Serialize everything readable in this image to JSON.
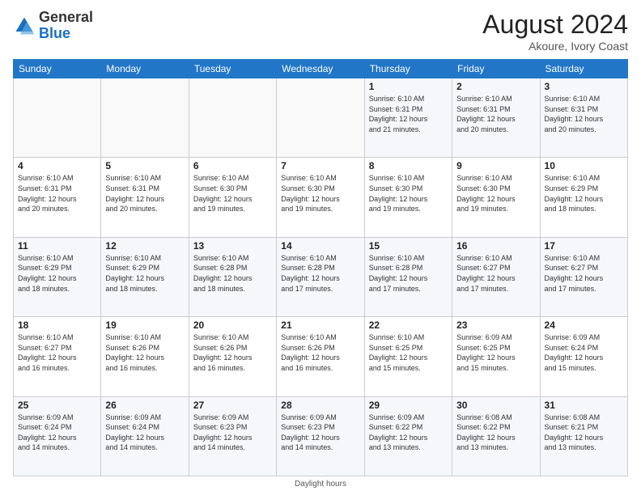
{
  "header": {
    "logo_general": "General",
    "logo_blue": "Blue",
    "month_year": "August 2024",
    "location": "Akoure, Ivory Coast"
  },
  "footer": {
    "daylight_label": "Daylight hours"
  },
  "days_of_week": [
    "Sunday",
    "Monday",
    "Tuesday",
    "Wednesday",
    "Thursday",
    "Friday",
    "Saturday"
  ],
  "weeks": [
    [
      {
        "num": "",
        "info": ""
      },
      {
        "num": "",
        "info": ""
      },
      {
        "num": "",
        "info": ""
      },
      {
        "num": "",
        "info": ""
      },
      {
        "num": "1",
        "info": "Sunrise: 6:10 AM\nSunset: 6:31 PM\nDaylight: 12 hours\nand 21 minutes."
      },
      {
        "num": "2",
        "info": "Sunrise: 6:10 AM\nSunset: 6:31 PM\nDaylight: 12 hours\nand 20 minutes."
      },
      {
        "num": "3",
        "info": "Sunrise: 6:10 AM\nSunset: 6:31 PM\nDaylight: 12 hours\nand 20 minutes."
      }
    ],
    [
      {
        "num": "4",
        "info": "Sunrise: 6:10 AM\nSunset: 6:31 PM\nDaylight: 12 hours\nand 20 minutes."
      },
      {
        "num": "5",
        "info": "Sunrise: 6:10 AM\nSunset: 6:31 PM\nDaylight: 12 hours\nand 20 minutes."
      },
      {
        "num": "6",
        "info": "Sunrise: 6:10 AM\nSunset: 6:30 PM\nDaylight: 12 hours\nand 19 minutes."
      },
      {
        "num": "7",
        "info": "Sunrise: 6:10 AM\nSunset: 6:30 PM\nDaylight: 12 hours\nand 19 minutes."
      },
      {
        "num": "8",
        "info": "Sunrise: 6:10 AM\nSunset: 6:30 PM\nDaylight: 12 hours\nand 19 minutes."
      },
      {
        "num": "9",
        "info": "Sunrise: 6:10 AM\nSunset: 6:30 PM\nDaylight: 12 hours\nand 19 minutes."
      },
      {
        "num": "10",
        "info": "Sunrise: 6:10 AM\nSunset: 6:29 PM\nDaylight: 12 hours\nand 18 minutes."
      }
    ],
    [
      {
        "num": "11",
        "info": "Sunrise: 6:10 AM\nSunset: 6:29 PM\nDaylight: 12 hours\nand 18 minutes."
      },
      {
        "num": "12",
        "info": "Sunrise: 6:10 AM\nSunset: 6:29 PM\nDaylight: 12 hours\nand 18 minutes."
      },
      {
        "num": "13",
        "info": "Sunrise: 6:10 AM\nSunset: 6:28 PM\nDaylight: 12 hours\nand 18 minutes."
      },
      {
        "num": "14",
        "info": "Sunrise: 6:10 AM\nSunset: 6:28 PM\nDaylight: 12 hours\nand 17 minutes."
      },
      {
        "num": "15",
        "info": "Sunrise: 6:10 AM\nSunset: 6:28 PM\nDaylight: 12 hours\nand 17 minutes."
      },
      {
        "num": "16",
        "info": "Sunrise: 6:10 AM\nSunset: 6:27 PM\nDaylight: 12 hours\nand 17 minutes."
      },
      {
        "num": "17",
        "info": "Sunrise: 6:10 AM\nSunset: 6:27 PM\nDaylight: 12 hours\nand 17 minutes."
      }
    ],
    [
      {
        "num": "18",
        "info": "Sunrise: 6:10 AM\nSunset: 6:27 PM\nDaylight: 12 hours\nand 16 minutes."
      },
      {
        "num": "19",
        "info": "Sunrise: 6:10 AM\nSunset: 6:26 PM\nDaylight: 12 hours\nand 16 minutes."
      },
      {
        "num": "20",
        "info": "Sunrise: 6:10 AM\nSunset: 6:26 PM\nDaylight: 12 hours\nand 16 minutes."
      },
      {
        "num": "21",
        "info": "Sunrise: 6:10 AM\nSunset: 6:26 PM\nDaylight: 12 hours\nand 16 minutes."
      },
      {
        "num": "22",
        "info": "Sunrise: 6:10 AM\nSunset: 6:25 PM\nDaylight: 12 hours\nand 15 minutes."
      },
      {
        "num": "23",
        "info": "Sunrise: 6:09 AM\nSunset: 6:25 PM\nDaylight: 12 hours\nand 15 minutes."
      },
      {
        "num": "24",
        "info": "Sunrise: 6:09 AM\nSunset: 6:24 PM\nDaylight: 12 hours\nand 15 minutes."
      }
    ],
    [
      {
        "num": "25",
        "info": "Sunrise: 6:09 AM\nSunset: 6:24 PM\nDaylight: 12 hours\nand 14 minutes."
      },
      {
        "num": "26",
        "info": "Sunrise: 6:09 AM\nSunset: 6:24 PM\nDaylight: 12 hours\nand 14 minutes."
      },
      {
        "num": "27",
        "info": "Sunrise: 6:09 AM\nSunset: 6:23 PM\nDaylight: 12 hours\nand 14 minutes."
      },
      {
        "num": "28",
        "info": "Sunrise: 6:09 AM\nSunset: 6:23 PM\nDaylight: 12 hours\nand 14 minutes."
      },
      {
        "num": "29",
        "info": "Sunrise: 6:09 AM\nSunset: 6:22 PM\nDaylight: 12 hours\nand 13 minutes."
      },
      {
        "num": "30",
        "info": "Sunrise: 6:08 AM\nSunset: 6:22 PM\nDaylight: 12 hours\nand 13 minutes."
      },
      {
        "num": "31",
        "info": "Sunrise: 6:08 AM\nSunset: 6:21 PM\nDaylight: 12 hours\nand 13 minutes."
      }
    ]
  ]
}
